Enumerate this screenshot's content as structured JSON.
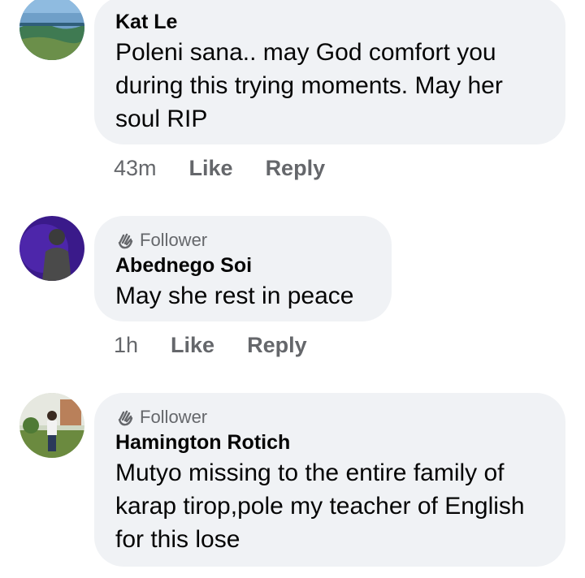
{
  "comments": [
    {
      "author": "Kat Le",
      "badge": "",
      "text": "Poleni sana.. may God comfort you during this trying moments. May her soul RIP",
      "time": "43m",
      "like": "Like",
      "reply": "Reply"
    },
    {
      "author": "Abednego Soi",
      "badge": "Follower",
      "text": "May she rest in peace",
      "time": "1h",
      "like": "Like",
      "reply": "Reply"
    },
    {
      "author": "Hamington Rotich",
      "badge": "Follower",
      "text": "Mutyo missing to the entire family of karap tirop,pole my teacher of English for this lose",
      "time": "",
      "like": "",
      "reply": ""
    }
  ],
  "icons": {
    "badge": "waving-hand-icon"
  },
  "colors": {
    "bubble": "#f0f2f5",
    "meta": "#65676b",
    "text": "#050505"
  }
}
